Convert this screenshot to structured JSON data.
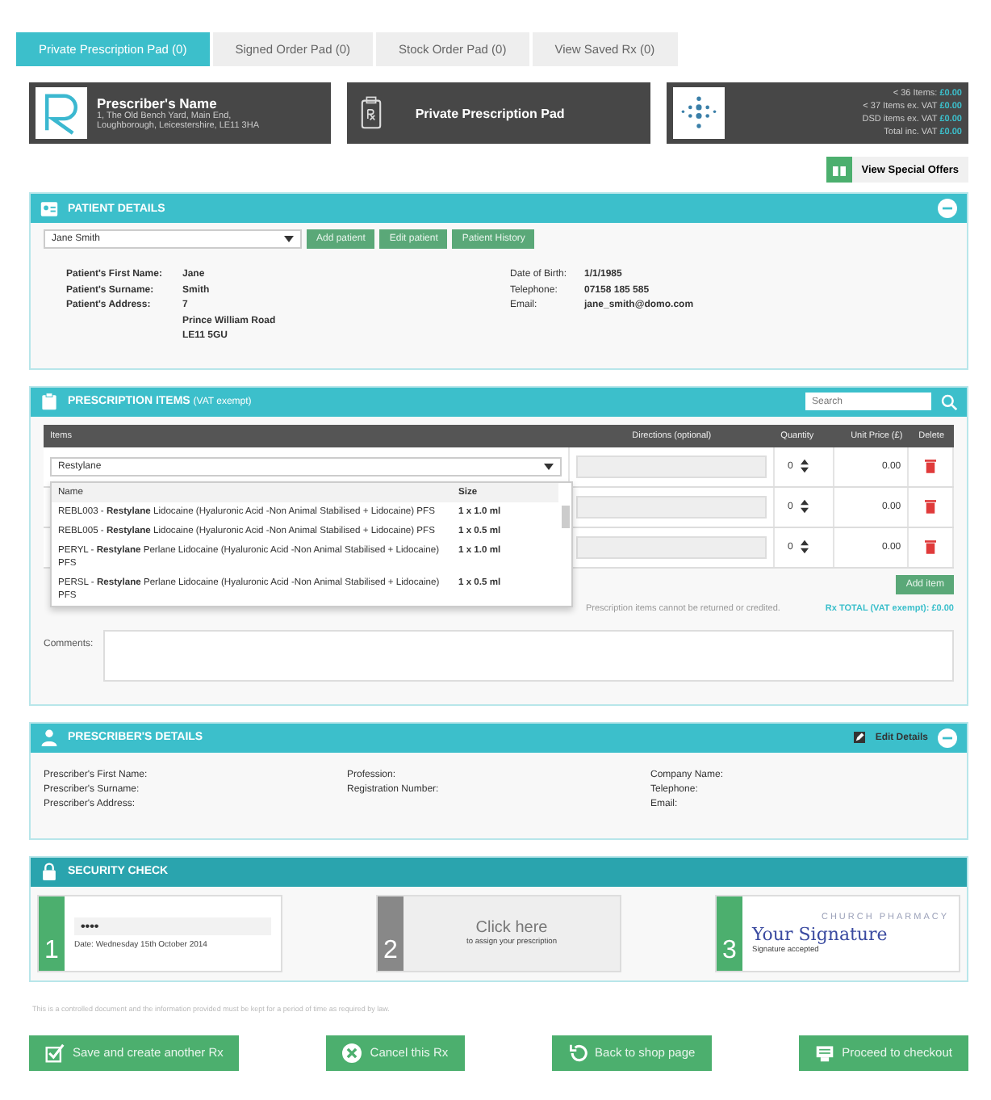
{
  "tabs": [
    {
      "label": "Private Prescription Pad (0)",
      "selected": true
    },
    {
      "label": "Signed Order Pad (0)",
      "selected": false
    },
    {
      "label": "Stock Order Pad (0)",
      "selected": false
    },
    {
      "label": "View Saved Rx (0)",
      "selected": false
    }
  ],
  "prescriber_card": {
    "name": "Prescriber's Name",
    "address_lines": [
      "1, The Old Bench Yard, Main End,",
      "Loughborough, Leicestershire, LE11 3HA"
    ]
  },
  "pad_card": {
    "title": "Private Prescription Pad"
  },
  "totals": [
    {
      "label": "< 36 Items:",
      "value": "£0.00"
    },
    {
      "label": "< 37 Items ex. VAT",
      "value": "£0.00"
    },
    {
      "label": "DSD items ex. VAT",
      "value": "£0.00"
    },
    {
      "label": "Total inc. VAT",
      "value": "£0.00"
    }
  ],
  "special_offers_button": "View Special Offers",
  "patient": {
    "title": "PATIENT DETAILS",
    "select_value": "Jane Smith",
    "buttons": [
      "Add patient",
      "Edit patient",
      "Patient History"
    ],
    "left_fields": [
      {
        "label": "Patient's First Name:",
        "lines": [
          "Jane"
        ]
      },
      {
        "label": "Patient's Surname:",
        "lines": [
          "Smith"
        ]
      },
      {
        "label": "Patient's Address:",
        "lines": [
          "7",
          "Prince William Road",
          "LE11 5GU"
        ]
      }
    ],
    "right_fields": [
      {
        "label": "Date of Birth:",
        "lines": [
          "1/1/1985"
        ]
      },
      {
        "label": "Telephone:",
        "lines": [
          "07158 185 585"
        ]
      },
      {
        "label": "Email:",
        "lines": [
          "jane_smith@domo.com"
        ]
      }
    ]
  },
  "items": {
    "title": "PRESCRIPTION ITEMS",
    "title_note": "(VAT exempt)",
    "search_placeholder": "Search",
    "columns": [
      "Items",
      "Directions (optional)",
      "Quantity",
      "Unit Price (£)",
      "Delete"
    ],
    "rows": [
      {
        "item": "Restylane",
        "quantity": "0",
        "price": "0.00"
      },
      {
        "quantity": "0",
        "price": "0.00"
      },
      {
        "quantity": "0",
        "price": "0.00"
      }
    ],
    "dropdown": {
      "columns": [
        "Name",
        "Size"
      ],
      "options": [
        {
          "text": "REBL003 - **Restylane** Lidocaine (Hyaluronic Acid -Non Animal Stabilised + Lidocaine) PFS",
          "size": "1 x 1.0 ml"
        },
        {
          "text": "REBL005 - **Restylane** Lidocaine (Hyaluronic Acid -Non Animal Stabilised + Lidocaine) PFS",
          "size": "1 x 0.5 ml"
        },
        {
          "text": "PERYL - **Restylane** Perlane Lidocaine (Hyaluronic Acid -Non Animal Stabilised + Lidocaine) PFS",
          "size": "1 x 1.0 ml"
        },
        {
          "text": "PERSL - **Restylane** Perlane Lidocaine (Hyaluronic Acid -Non Animal Stabilised + Lidocaine) PFS",
          "size": "1 x 0.5 ml"
        }
      ]
    },
    "add_button": "Add item",
    "note": "Prescription items cannot be returned or credited.",
    "total": "Rx TOTAL (VAT exempt): £0.00",
    "comments_label": "Comments:"
  },
  "prescriber": {
    "title": "PRESCRIBER'S DETAILS",
    "edit_label": "Edit Details",
    "columns": [
      [
        "Prescriber's First Name:",
        "Prescriber's Surname:",
        "Prescriber's Address:"
      ],
      [
        "Profession:",
        "Registration Number:"
      ],
      [
        "Company Name:",
        "Telephone:",
        "Email:"
      ]
    ]
  },
  "security": {
    "title": "SECURITY CHECK",
    "steps": [
      {
        "number": "1",
        "kind": "password",
        "value": "••••",
        "caption": "Date: Wednesday 15th October 2014"
      },
      {
        "number": "2",
        "kind": "click",
        "value": "Click here",
        "caption": "to assign your prescription"
      },
      {
        "number": "3",
        "kind": "signature",
        "value": "Your Signature",
        "backdrop": "CHURCH PHARMACY",
        "caption": "Signature accepted"
      }
    ]
  },
  "disclaimer": "This is a controlled document and the information provided must be kept for a period of time as required by law.",
  "actions": [
    {
      "label": "Save and create another Rx"
    },
    {
      "label": "Cancel this Rx"
    },
    {
      "label": "Back to shop page"
    },
    {
      "label": "Proceed to checkout"
    }
  ]
}
